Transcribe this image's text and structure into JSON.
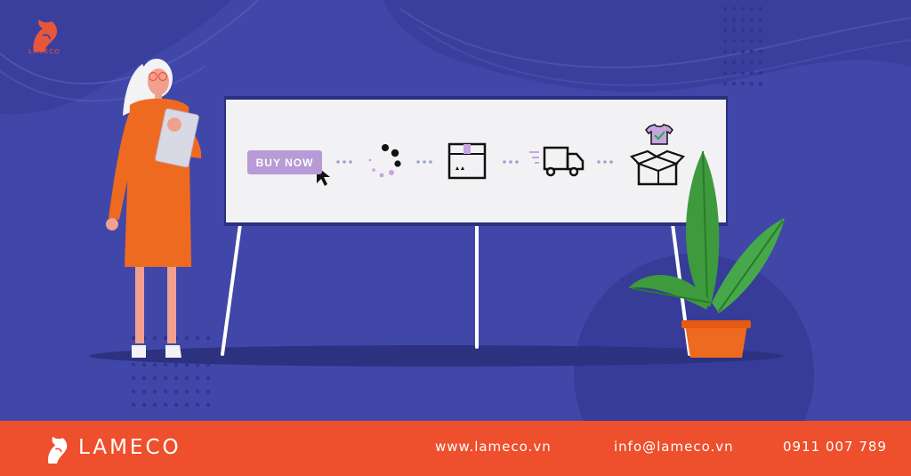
{
  "brand": {
    "name": "LAMECO",
    "top_logo_text": "LAMECO",
    "accent_color": "#ee4f2c",
    "background_color": "#4147a8"
  },
  "board": {
    "buy_button_label": "BUY NOW",
    "steps": [
      {
        "icon": "cursor-click-icon"
      },
      {
        "icon": "loading-spinner-icon"
      },
      {
        "icon": "package-box-icon"
      },
      {
        "icon": "delivery-truck-icon"
      },
      {
        "icon": "open-box-tshirt-icon"
      }
    ]
  },
  "footer": {
    "website": "www.lameco.vn",
    "email": "info@lameco.vn",
    "phone": "0911 007 789"
  }
}
